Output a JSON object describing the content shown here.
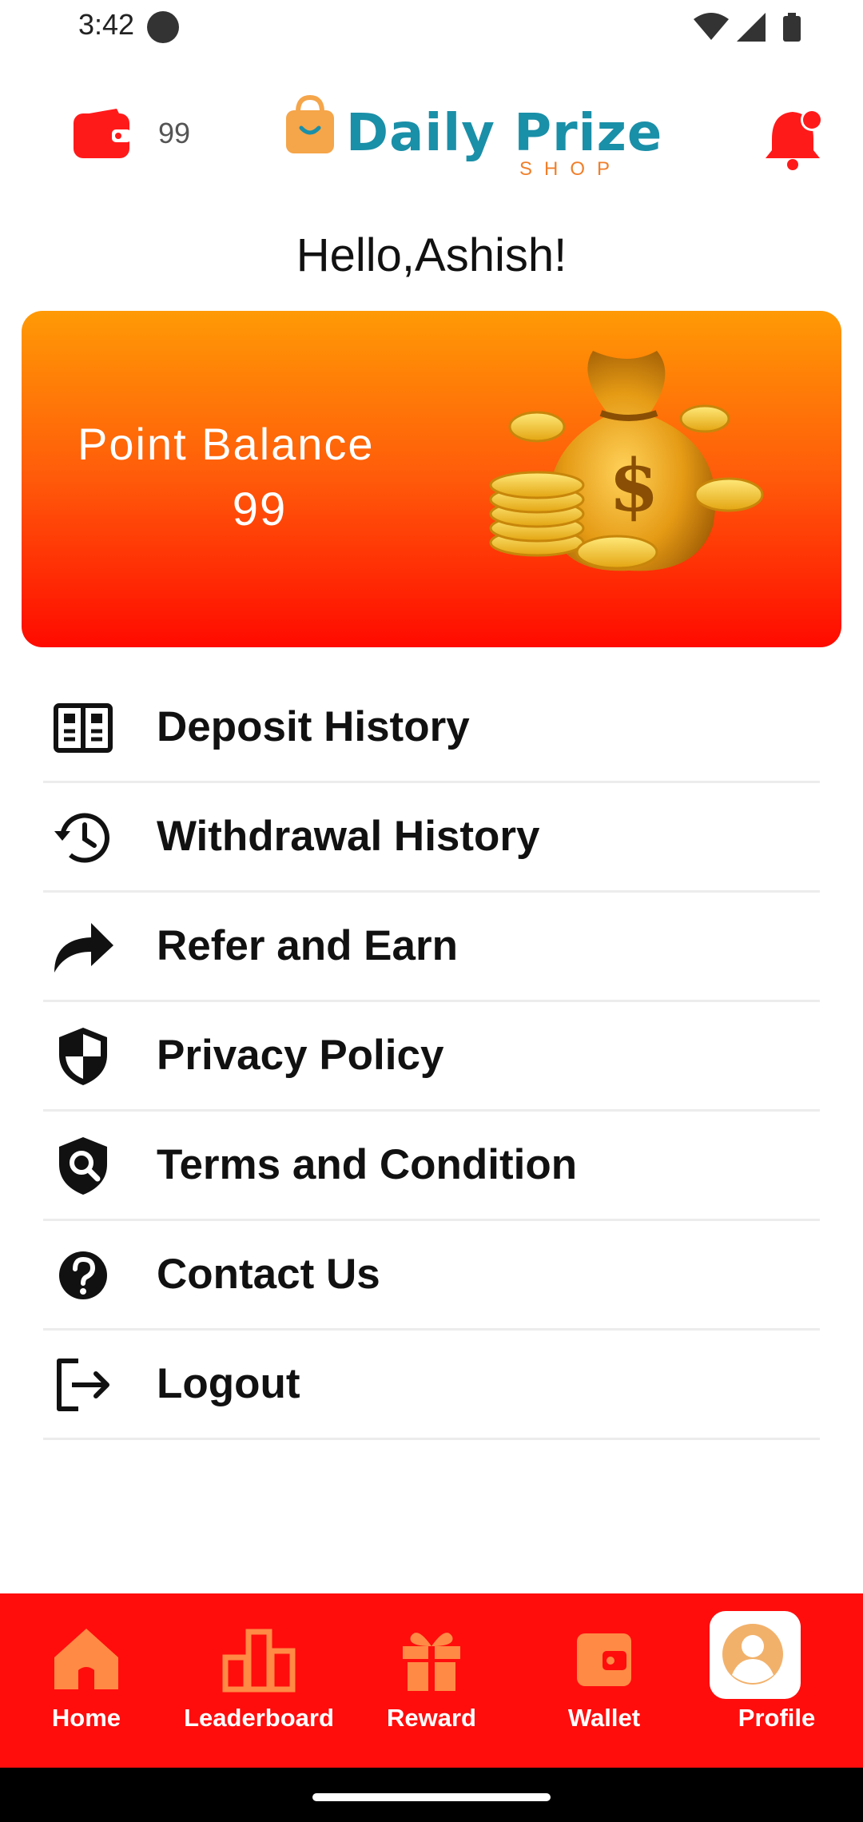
{
  "status_bar": {
    "time": "3:42"
  },
  "header": {
    "wallet_points": "99",
    "logo_title": "Daily Prize",
    "logo_subtitle": "SHOP"
  },
  "greeting": "Hello,Ashish!",
  "balance_card": {
    "label": "Point Balance",
    "value": "99"
  },
  "menu": [
    {
      "label": "Deposit History",
      "icon": "deposit-history-icon"
    },
    {
      "label": "Withdrawal History",
      "icon": "history-icon"
    },
    {
      "label": "Refer and Earn",
      "icon": "share-arrow-icon"
    },
    {
      "label": "Privacy Policy",
      "icon": "shield-icon"
    },
    {
      "label": "Terms and Condition",
      "icon": "search-shield-icon"
    },
    {
      "label": "Contact Us",
      "icon": "help-icon"
    },
    {
      "label": "Logout",
      "icon": "logout-icon"
    }
  ],
  "bottom_nav": [
    {
      "label": "Home",
      "icon": "home-icon",
      "active": false
    },
    {
      "label": "Leaderboard",
      "icon": "leaderboard-icon",
      "active": false
    },
    {
      "label": "Reward",
      "icon": "gift-icon",
      "active": false
    },
    {
      "label": "Wallet",
      "icon": "wallet-icon",
      "active": false
    },
    {
      "label": "Profile",
      "icon": "profile-icon",
      "active": true
    }
  ],
  "colors": {
    "accent_red": "#ff0d0d",
    "nav_icon_orange": "#ff8a45",
    "nav_icon_active": "#f2b16a",
    "card_gradient_top": "#ff9a05",
    "card_gradient_bottom": "#ff0a00",
    "logo_teal": "#1a8fa8",
    "logo_orange": "#f07f2a"
  }
}
